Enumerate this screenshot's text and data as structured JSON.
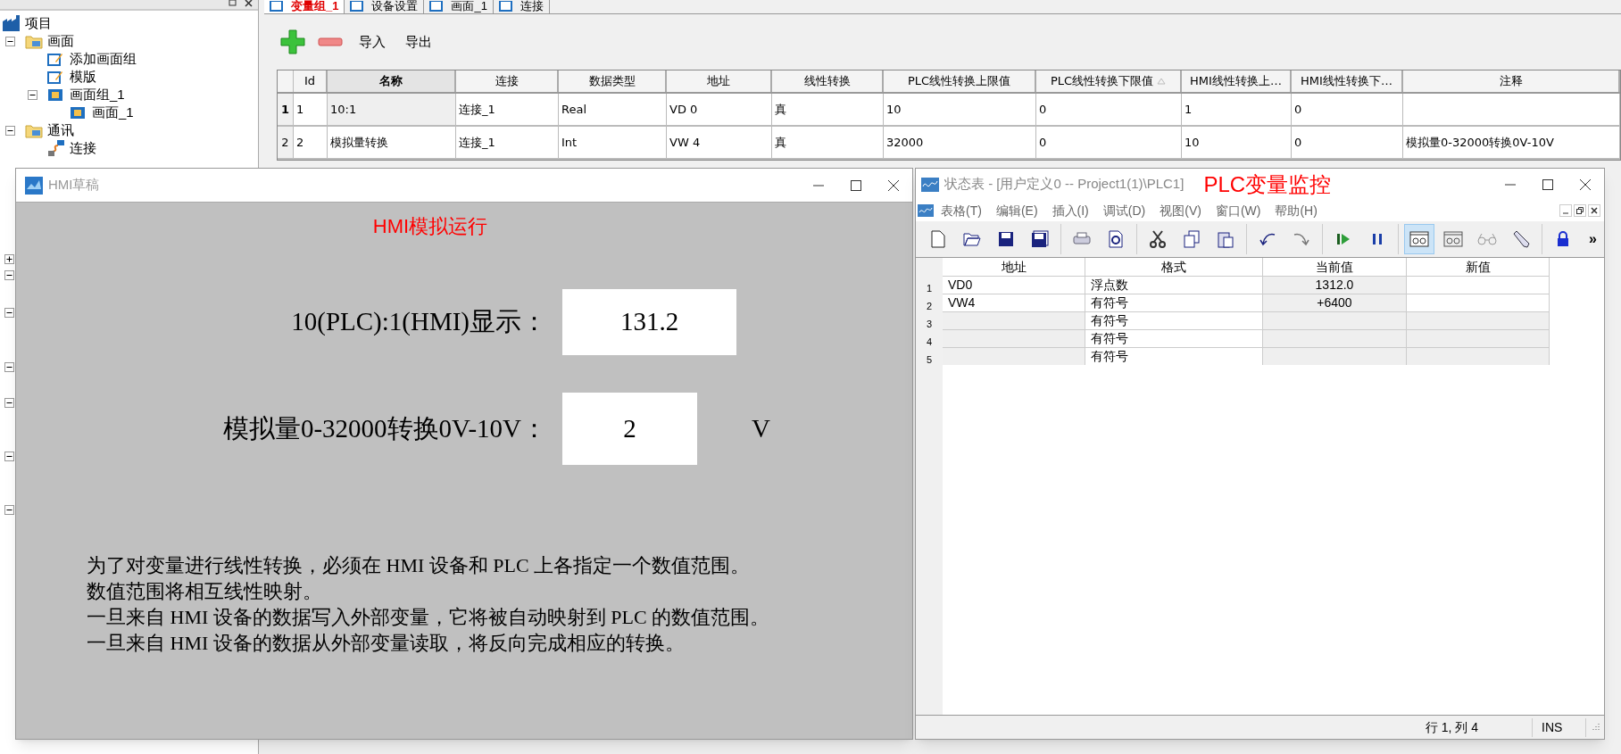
{
  "project_tree": {
    "label": "项目",
    "children": [
      {
        "label": "画面",
        "expanded": true,
        "children": [
          {
            "label": "添加画面组",
            "kind": "edit"
          },
          {
            "label": "模版",
            "kind": "edit"
          },
          {
            "label": "画面组_1",
            "kind": "screen",
            "expanded": true,
            "children": [
              {
                "label": "画面_1",
                "kind": "screen"
              }
            ]
          }
        ]
      },
      {
        "label": "通讯",
        "expanded": true,
        "children": [
          {
            "label": "连接",
            "kind": "link"
          }
        ]
      }
    ]
  },
  "hidden_tree_toggles": [
    {
      "expanded": false
    },
    {
      "expanded": true
    },
    {
      "expanded": true
    },
    {
      "expanded": true
    },
    {
      "expanded": true
    },
    {
      "expanded": true
    },
    {
      "expanded": true
    }
  ],
  "tabs": [
    {
      "label": "变量组_1",
      "selected": true
    },
    {
      "label": "设备设置",
      "selected": false
    },
    {
      "label": "画面_1",
      "selected": false
    },
    {
      "label": "连接",
      "selected": false
    }
  ],
  "toolbar": {
    "import": "导入",
    "export": "导出"
  },
  "table": {
    "columns": [
      {
        "label": "Id",
        "selected": false,
        "sorted": false
      },
      {
        "label": "名称",
        "selected": true,
        "sorted": false
      },
      {
        "label": "连接",
        "selected": false,
        "sorted": false
      },
      {
        "label": "数据类型",
        "selected": false,
        "sorted": false
      },
      {
        "label": "地址",
        "selected": false,
        "sorted": false
      },
      {
        "label": "线性转换",
        "selected": false,
        "sorted": false
      },
      {
        "label": "PLC线性转换上限值",
        "selected": false,
        "sorted": false
      },
      {
        "label": "PLC线性转换下限值",
        "selected": false,
        "sorted": true
      },
      {
        "label": "HMI线性转换上…",
        "selected": false,
        "sorted": false
      },
      {
        "label": "HMI线性转换下…",
        "selected": false,
        "sorted": false
      },
      {
        "label": "注释",
        "selected": false,
        "sorted": false
      }
    ],
    "rows": [
      {
        "number": "1",
        "selected": true,
        "cells": [
          "1",
          "10:1",
          "连接_1",
          "Real",
          "VD 0",
          "真",
          "10",
          "0",
          "1",
          "0",
          ""
        ]
      },
      {
        "number": "2",
        "selected": false,
        "cells": [
          "2",
          "模拟量转换",
          "连接_1",
          "Int",
          "VW 4",
          "真",
          "32000",
          "0",
          "10",
          "0",
          "模拟量0-32000转换0V-10V"
        ]
      }
    ]
  },
  "hmi_window": {
    "title": "HMI草稿",
    "heading": "HMI模拟运行",
    "fields": [
      {
        "label": "10(PLC):1(HMI)显示：",
        "value": "131.2"
      },
      {
        "label": "模拟量0-32000转换0V-10V：",
        "value": "2",
        "unit": "V"
      }
    ],
    "description": [
      "为了对变量进行线性转换，必须在 HMI 设备和 PLC 上各指定一个数值范围。",
      "数值范围将相互线性映射。",
      "一旦来自 HMI 设备的数据写入外部变量，它将被自动映射到 PLC 的数值范围。",
      "一旦来自 HMI 设备的数据从外部变量读取，将反向完成相应的转换。"
    ]
  },
  "status_window": {
    "title": "状态表 - [用户定义0 -- Project1(1)\\PLC1]",
    "annotation": "PLC变量监控",
    "menu": [
      "表格(T)",
      "编辑(E)",
      "插入(I)",
      "调试(D)",
      "视图(V)",
      "窗口(W)",
      "帮助(H)"
    ],
    "toolbar": [
      {
        "pressed": false
      },
      {
        "pressed": false
      },
      {
        "pressed": false
      },
      {
        "pressed": false
      },
      {
        "pressed": false
      },
      {
        "pressed": false
      },
      {
        "pressed": false
      },
      {
        "pressed": false
      },
      {
        "pressed": false
      },
      {
        "pressed": false
      },
      {
        "pressed": false
      },
      {
        "pressed": false
      },
      {
        "pressed": false
      },
      {
        "pressed": true
      },
      {
        "pressed": false
      },
      {
        "pressed": false
      },
      {
        "pressed": false
      },
      {
        "pressed": false
      }
    ],
    "toolbar_overflow": "»",
    "columns": [
      "地址",
      "格式",
      "当前值",
      "新值"
    ],
    "rows": [
      {
        "number": "1",
        "cells": [
          "VD0",
          "浮点数",
          "1312.0",
          ""
        ]
      },
      {
        "number": "2",
        "cells": [
          "VW4",
          "有符号",
          "+6400",
          ""
        ]
      },
      {
        "number": "3",
        "cells": [
          "",
          "有符号",
          "",
          ""
        ]
      },
      {
        "number": "4",
        "cells": [
          "",
          "有符号",
          "",
          ""
        ]
      },
      {
        "number": "5",
        "cells": [
          "",
          "有符号",
          "",
          ""
        ]
      }
    ],
    "status": {
      "position": "行 1, 列 4",
      "mode": "INS"
    }
  }
}
